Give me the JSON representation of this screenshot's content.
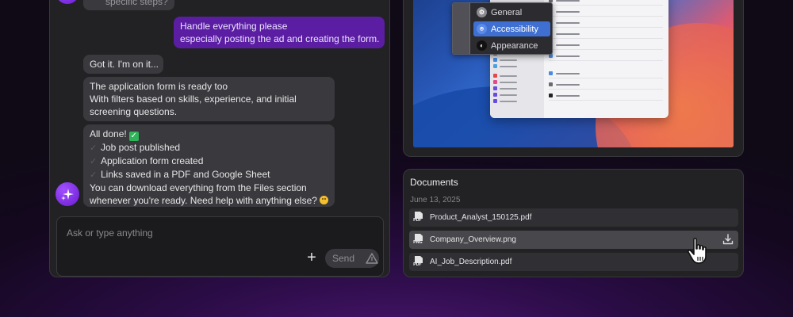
{
  "chat": {
    "partial_message": "specific steps?",
    "user_message": {
      "lines": [
        "Handle everything please",
        "especially posting the ad and creating the form."
      ]
    },
    "reply_ack": "Got it. I'm on it...",
    "reply_form": {
      "lines": [
        "The application form is ready too",
        "With filters based on skills, experience, and initial",
        "screening questions."
      ]
    },
    "reply_done": {
      "heading": "All done!",
      "checklist": [
        "Job post published",
        "Application form created",
        "Links saved in a PDF and Google Sheet"
      ],
      "closing_lines": [
        "You can download everything from the Files section",
        "whenever you're ready. Need help with anything else?"
      ]
    },
    "input": {
      "placeholder": "Ask or type anything",
      "value": ""
    },
    "send_label": "Send",
    "accent_color": "#5b1ea3"
  },
  "preview": {
    "menu_items": [
      {
        "label": "General",
        "icon": "gear-icon",
        "active": false
      },
      {
        "label": "Accessibility",
        "icon": "accessibility-icon",
        "active": true
      },
      {
        "label": "Appearance",
        "icon": "appearance-icon",
        "active": false
      }
    ]
  },
  "documents": {
    "title": "Documents",
    "date": "June 13, 2025",
    "files": [
      {
        "name": "Product_Analyst_150125.pdf",
        "type": "PDF",
        "hovered": false
      },
      {
        "name": "Company_Overview.png",
        "type": "PNG",
        "hovered": true
      },
      {
        "name": "AI_Job_Description.pdf",
        "type": "PDF",
        "hovered": false
      }
    ]
  }
}
